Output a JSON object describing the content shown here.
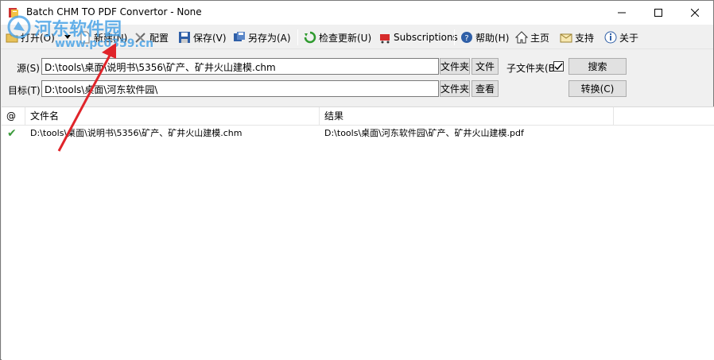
{
  "window": {
    "title": "Batch CHM TO PDF Convertor - None"
  },
  "toolbar": {
    "open": "打开(O)",
    "new": "新建(N)",
    "config": "配置",
    "save": "保存(V)",
    "save_as": "另存为(A)",
    "check_update": "检查更新(U)",
    "subscriptions": "Subscriptions",
    "help": "帮助(H)",
    "home": "主页",
    "support": "支持",
    "about": "关于"
  },
  "form": {
    "source_label": "源(S)",
    "source_value": "D:\\tools\\桌面\\说明书\\5356\\矿产、矿井火山建模.chm",
    "folder_btn": "文件夹",
    "file_btn": "文件",
    "subfolder_label": "子文件夹(B",
    "subfolder_checked": true,
    "search_btn": "搜索",
    "target_label": "目标(T)",
    "target_value": "D:\\tools\\桌面\\河东软件园\\",
    "target_folder_btn": "文件夹",
    "view_btn": "查看",
    "convert_btn": "转换(C)"
  },
  "list": {
    "columns": [
      "@",
      "文件名",
      "结果"
    ],
    "rows": [
      {
        "status": "✔",
        "filename": "D:\\tools\\桌面\\说明书\\5356\\矿产、矿井火山建模.chm",
        "result": "D:\\tools\\桌面\\河东软件园\\矿产、矿井火山建模.pdf"
      }
    ]
  },
  "watermark": {
    "title": "河东软件园",
    "url": "www.pc0359.cn"
  },
  "colors": {
    "accent": "#4aa3e6",
    "arrow": "#e0242a",
    "check": "#3a9a3a"
  }
}
